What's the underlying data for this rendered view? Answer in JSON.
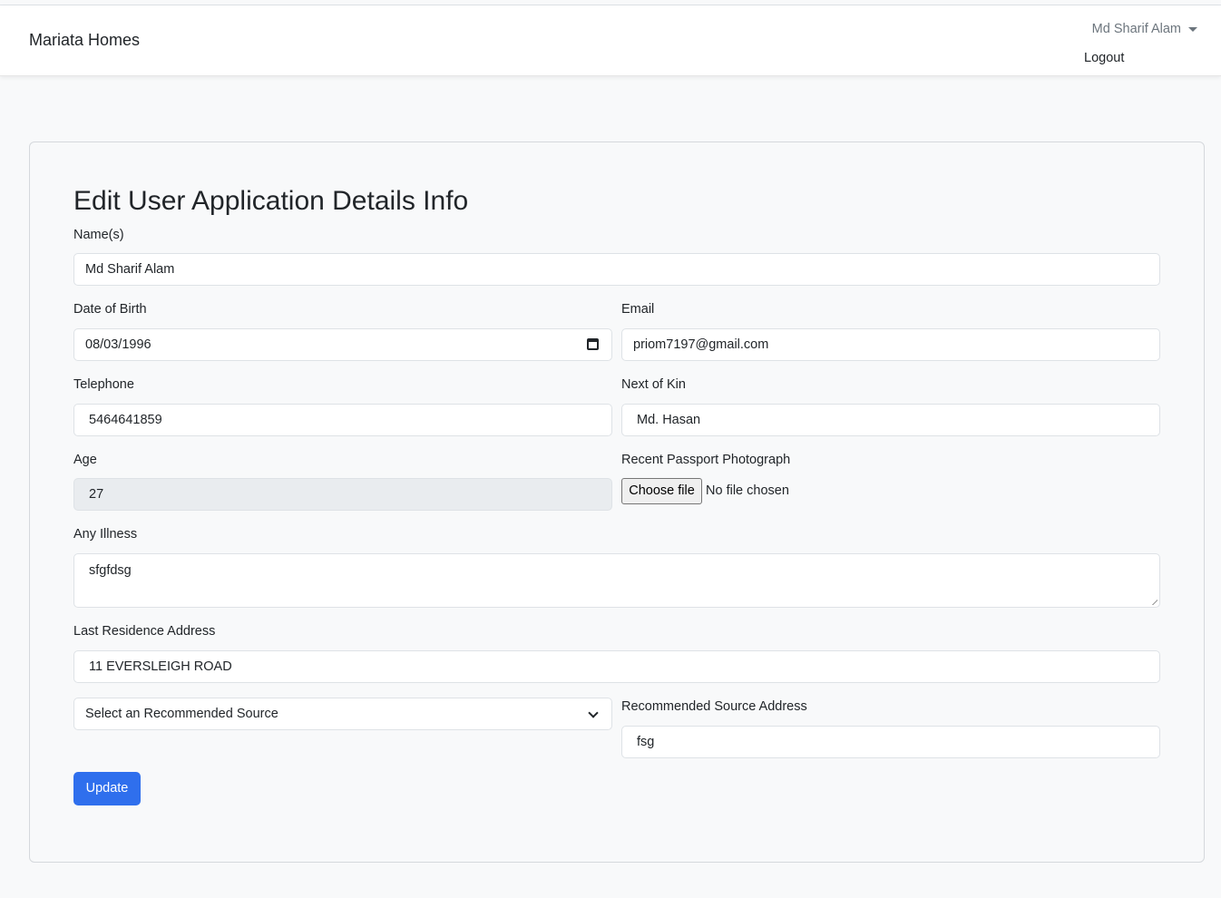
{
  "navbar": {
    "brand": "Mariata Homes",
    "user_name": "Md Sharif Alam",
    "logout_label": "Logout"
  },
  "form": {
    "title": "Edit User Application Details Info",
    "names": {
      "label": "Name(s)",
      "value": "Md Sharif Alam"
    },
    "dob": {
      "label": "Date of Birth",
      "value": "08/03/1996",
      "icon": "calendar-icon"
    },
    "email": {
      "label": "Email",
      "value": "priom7197@gmail.com"
    },
    "telephone": {
      "label": "Telephone",
      "value": "5464641859"
    },
    "next_of_kin": {
      "label": "Next of Kin",
      "value": "Md. Hasan"
    },
    "age": {
      "label": "Age",
      "value": "27"
    },
    "passport_photo": {
      "label": "Recent Passport Photograph",
      "button_label": "Choose file",
      "status": "No file chosen"
    },
    "illness": {
      "label": "Any Illness",
      "value": "sfgfdsg"
    },
    "last_address": {
      "label": "Last Residence Address",
      "value": "11 EVERSLEIGH ROAD"
    },
    "recommended_source": {
      "selected": "Select an Recommended Source",
      "icon": "chevron-down-icon"
    },
    "recommended_address": {
      "label": "Recommended Source Address",
      "value": "fsg"
    },
    "submit_label": "Update"
  },
  "colors": {
    "primary": "#2f6fed",
    "page_bg": "#f8f9fa",
    "disabled_bg": "#e9ecef"
  }
}
